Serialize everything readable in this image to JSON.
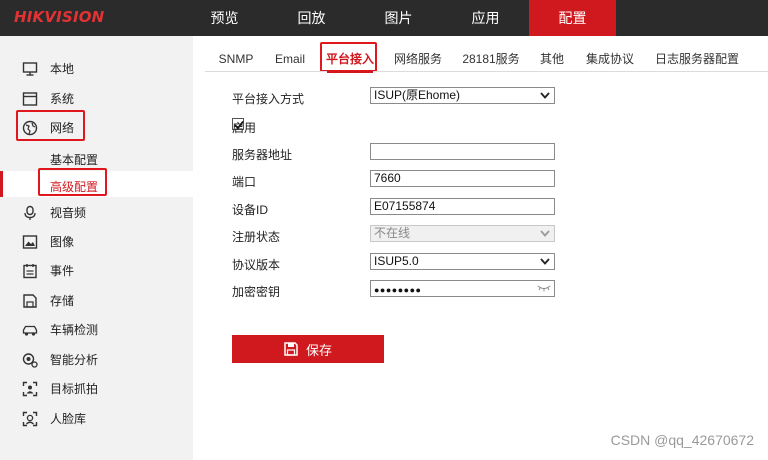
{
  "brand": {
    "logo": "HIKVISION"
  },
  "nav": {
    "items": [
      "预览",
      "回放",
      "图片",
      "应用",
      "配置"
    ],
    "active": "配置"
  },
  "sidebar": {
    "items": {
      "local": "本地",
      "system": "系统",
      "network": "网络",
      "network_basic": "基本配置",
      "network_advanced": "高级配置",
      "video_audio": "视音频",
      "image": "图像",
      "event": "事件",
      "storage": "存储",
      "vehicle": "车辆检测",
      "smart": "智能分析",
      "target": "目标抓拍",
      "face": "人脸库"
    }
  },
  "tabs": {
    "snmp": "SNMP",
    "email": "Email",
    "platform": "平台接入",
    "netservice": "网络服务",
    "gb28181": "28181服务",
    "other": "其他",
    "integration": "集成协议",
    "logserver": "日志服务器配置"
  },
  "form": {
    "access_mode_label": "平台接入方式",
    "access_mode_value": "ISUP(原Ehome)",
    "enable_label": "启用",
    "enable_checked": true,
    "server_label": "服务器地址",
    "server_value": "",
    "port_label": "端口",
    "port_value": "7660",
    "device_id_label": "设备ID",
    "device_id_value": "E07155874",
    "reg_status_label": "注册状态",
    "reg_status_value": "不在线",
    "protocol_label": "协议版本",
    "protocol_value": "ISUP5.0",
    "key_label": "加密密钥",
    "key_value": "●●●●●●●●"
  },
  "save_button": "保存",
  "watermark": "CSDN @qq_42670672",
  "colors": {
    "accent": "#d0191f",
    "topbar": "#2b2b2b",
    "sidebar": "#f2f2f2"
  }
}
